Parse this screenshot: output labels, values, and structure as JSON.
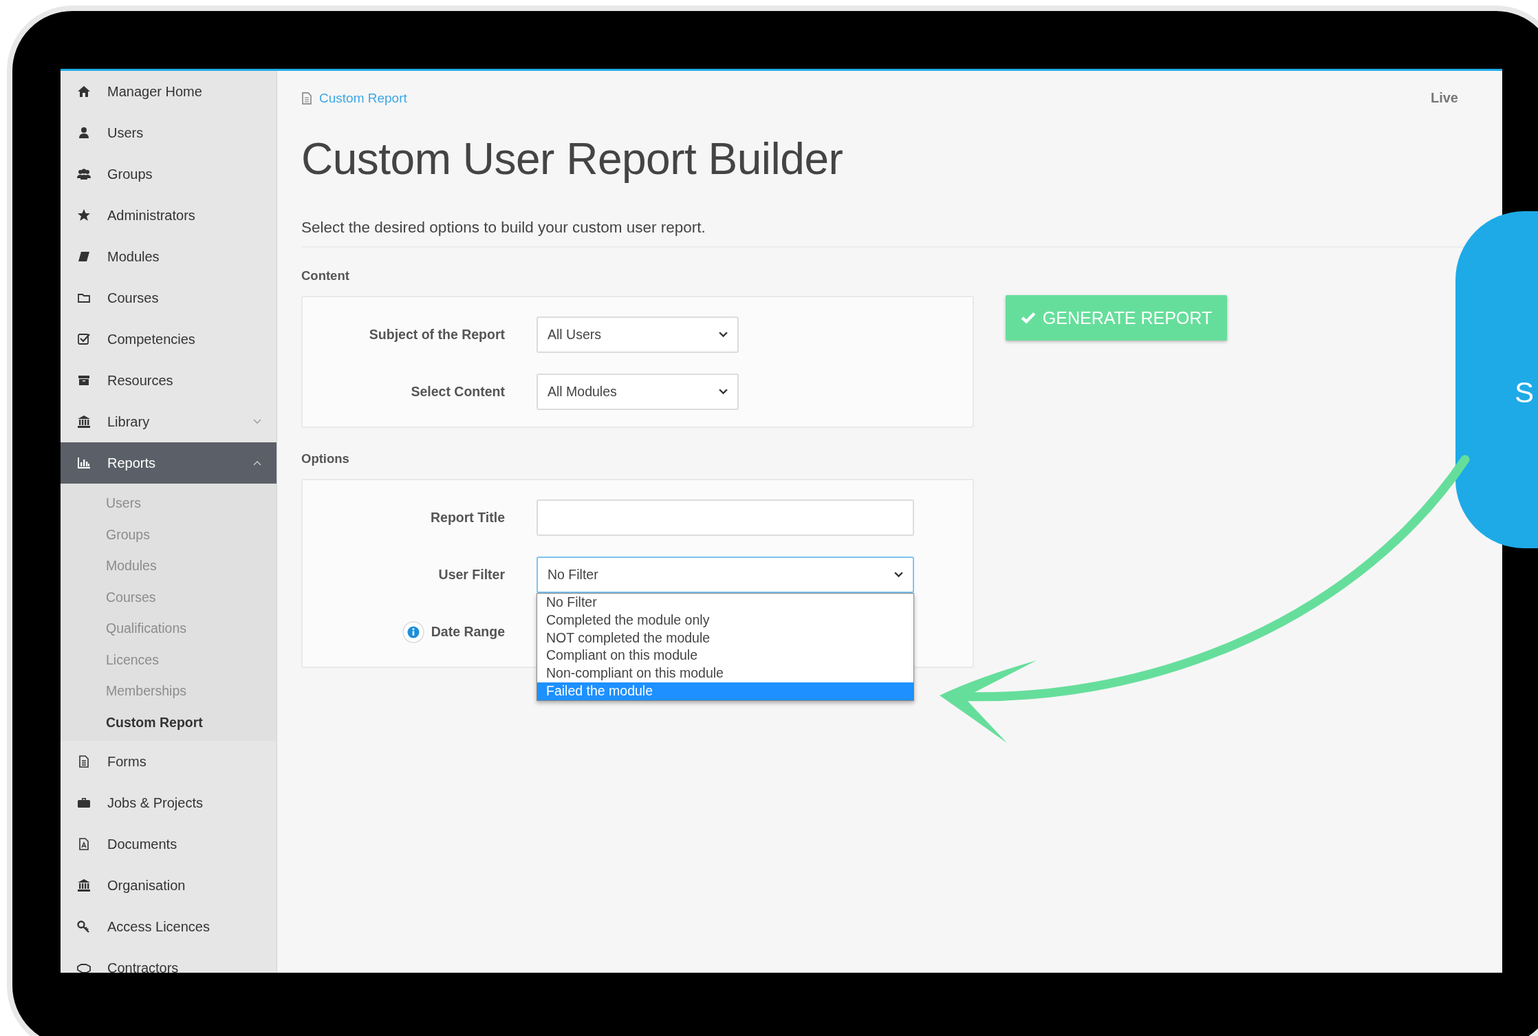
{
  "sidebar": {
    "items": [
      {
        "label": "Manager Home",
        "selected": false
      },
      {
        "label": "Users",
        "selected": false
      },
      {
        "label": "Groups",
        "selected": false
      },
      {
        "label": "Administrators",
        "selected": false
      },
      {
        "label": "Modules",
        "selected": false
      },
      {
        "label": "Courses",
        "selected": false
      },
      {
        "label": "Competencies",
        "selected": false
      },
      {
        "label": "Resources",
        "selected": false
      },
      {
        "label": "Library",
        "selected": false,
        "expanded": false
      },
      {
        "label": "Reports",
        "selected": true,
        "expanded": true,
        "children": [
          {
            "label": "Users",
            "selected": false
          },
          {
            "label": "Groups",
            "selected": false
          },
          {
            "label": "Modules",
            "selected": false
          },
          {
            "label": "Courses",
            "selected": false
          },
          {
            "label": "Qualifications",
            "selected": false
          },
          {
            "label": "Licences",
            "selected": false
          },
          {
            "label": "Memberships",
            "selected": false
          },
          {
            "label": "Custom Report",
            "selected": true
          }
        ]
      },
      {
        "label": "Forms",
        "selected": false
      },
      {
        "label": "Jobs & Projects",
        "selected": false
      },
      {
        "label": "Documents",
        "selected": false
      },
      {
        "label": "Organisation",
        "selected": false
      },
      {
        "label": "Access Licences",
        "selected": false
      },
      {
        "label": "Contractors",
        "selected": false
      }
    ]
  },
  "breadcrumb": "Custom Report",
  "status": "Live",
  "title": "Custom User Report Builder",
  "subtitle": "Select the desired options to build your custom user report.",
  "content": {
    "heading": "Content",
    "fields": [
      {
        "label": "Subject of the Report",
        "kind": "select",
        "value": "All Users"
      },
      {
        "label": "Select Content",
        "kind": "select",
        "value": "All Modules"
      }
    ]
  },
  "generate_button": "GENERATE REPORT",
  "options": {
    "heading": "Options",
    "fields": [
      {
        "label": "Report Title",
        "kind": "text"
      },
      {
        "label": "User Filter",
        "kind": "select",
        "value": "No Filter",
        "expanded": true,
        "options": [
          {
            "label": "No Filter",
            "highlighted": false
          },
          {
            "label": "Completed the module only",
            "highlighted": false
          },
          {
            "label": "NOT completed the module",
            "highlighted": false
          },
          {
            "label": "Compliant on this module",
            "highlighted": false
          },
          {
            "label": "Non-compliant on this module",
            "highlighted": false
          },
          {
            "label": "Failed the module",
            "highlighted": true
          }
        ]
      },
      {
        "label": "Date Range",
        "kind": "date"
      }
    ]
  },
  "callout": {
    "text": "S"
  }
}
